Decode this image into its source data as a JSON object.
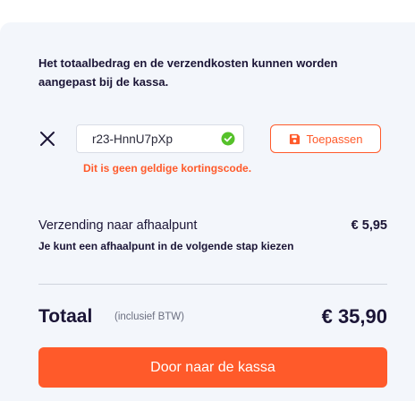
{
  "cart": {
    "note": "Het totaalbedrag en de verzendkosten kunnen worden aangepast bij de kassa."
  },
  "coupon": {
    "code_value": "r23-HnnU7pXp",
    "apply_label": "Toepassen",
    "error_text": "Dit is geen geldige kortingscode.",
    "icons": {
      "remove": "close-icon",
      "valid": "check-circle-icon",
      "apply": "save-icon"
    }
  },
  "shipping": {
    "title": "Verzending naar afhaalpunt",
    "price": "€ 5,95",
    "subtitle": "Je kunt een afhaalpunt in de volgende stap kiezen"
  },
  "total": {
    "label": "Totaal",
    "note": "(inclusief BTW)",
    "price": "€ 35,90"
  },
  "checkout": {
    "label": "Door naar de kassa"
  },
  "colors": {
    "accent": "#ff5a2a",
    "panel": "#f3f6fb",
    "text": "#1b1536",
    "valid": "#55c12a"
  }
}
